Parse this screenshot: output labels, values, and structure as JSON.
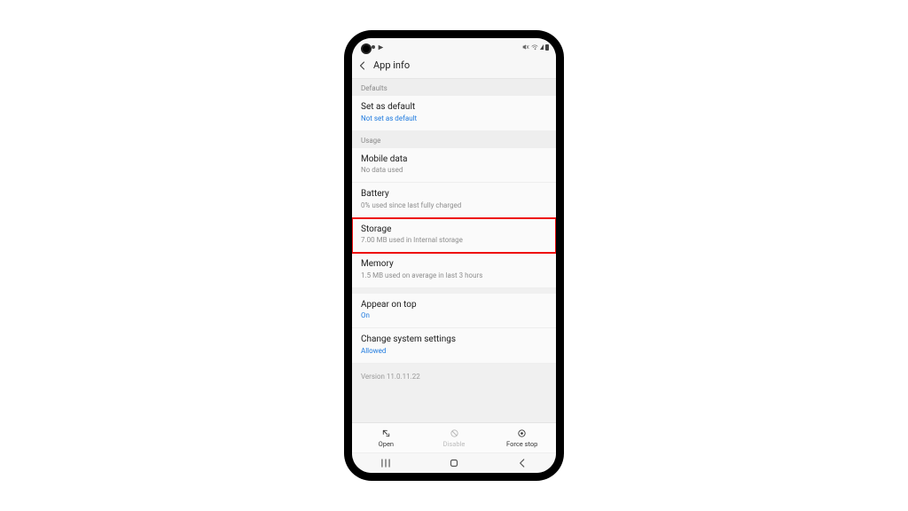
{
  "header": {
    "title": "App info"
  },
  "sections": {
    "defaults": {
      "label": "Defaults",
      "set_as_default": {
        "title": "Set as default",
        "subtitle": "Not set as default"
      }
    },
    "usage": {
      "label": "Usage",
      "mobile_data": {
        "title": "Mobile data",
        "subtitle": "No data used"
      },
      "battery": {
        "title": "Battery",
        "subtitle": "0% used since last fully charged"
      },
      "storage": {
        "title": "Storage",
        "subtitle": "7.00 MB used in Internal storage"
      },
      "memory": {
        "title": "Memory",
        "subtitle": "1.5 MB used on average in last 3 hours"
      }
    },
    "advanced": {
      "appear_on_top": {
        "title": "Appear on top",
        "subtitle": "On"
      },
      "change_system_settings": {
        "title": "Change system settings",
        "subtitle": "Allowed"
      }
    }
  },
  "version_text": "Version 11.0.11.22",
  "actions": {
    "open": {
      "label": "Open"
    },
    "disable": {
      "label": "Disable"
    },
    "force_stop": {
      "label": "Force stop"
    }
  }
}
